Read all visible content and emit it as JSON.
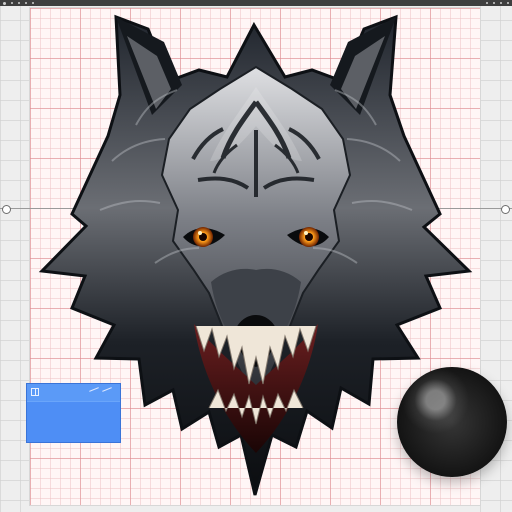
{
  "window": {
    "top_strip_indicator": "",
    "top_strip_right_indicator": ""
  },
  "canvas": {
    "background_color": "#fff6f6",
    "grid_minor_color": "#eec4c6",
    "grid_major_color": "#df8b91"
  },
  "guide": {
    "line_color": "#9a9a9a"
  },
  "artwork": {
    "subject": "",
    "eye_color": "#ff9c1a",
    "fur_dark": "#171b20",
    "fur_light": "#d6d7db"
  },
  "panel": {
    "color": "#4e8ef5"
  },
  "sphere": {
    "color": "#111111"
  }
}
